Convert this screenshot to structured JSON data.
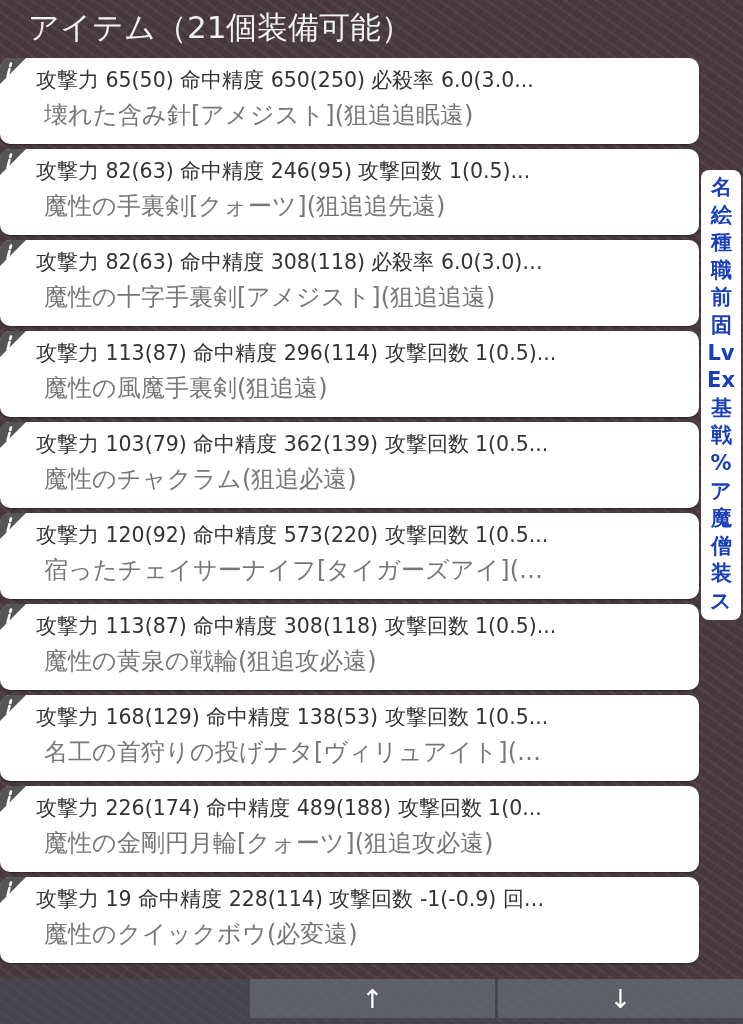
{
  "header": {
    "title": "アイテム（21個装備可能）"
  },
  "items": [
    {
      "stats": "攻撃力 65(50) 命中精度 650(250) 必殺率 6.0(3.0...",
      "name": "壊れた含み針[アメジスト](狙追追眠遠)"
    },
    {
      "stats": "攻撃力 82(63) 命中精度 246(95) 攻撃回数 1(0.5)...",
      "name": "魔性の手裏剣[クォーツ](狙追追先遠)"
    },
    {
      "stats": "攻撃力 82(63) 命中精度 308(118) 必殺率 6.0(3.0)…",
      "name": "魔性の十字手裏剣[アメジスト](狙追追遠)"
    },
    {
      "stats": "攻撃力 113(87) 命中精度 296(114) 攻撃回数 1(0.5)...",
      "name": "魔性の風魔手裏剣(狙追遠)"
    },
    {
      "stats": "攻撃力 103(79) 命中精度 362(139) 攻撃回数 1(0.5...",
      "name": "魔性のチャクラム(狙追必遠)"
    },
    {
      "stats": "攻撃力 120(92) 命中精度 573(220) 攻撃回数 1(0.5...",
      "name": "宿ったチェイサーナイフ[タイガーズアイ](…"
    },
    {
      "stats": "攻撃力 113(87) 命中精度 308(118) 攻撃回数 1(0.5)...",
      "name": "魔性の黄泉の戦輪(狙追攻必遠)"
    },
    {
      "stats": "攻撃力 168(129) 命中精度 138(53) 攻撃回数 1(0.5...",
      "name": "名工の首狩りの投げナタ[ヴィリュアイト](…"
    },
    {
      "stats": "攻撃力 226(174) 命中精度 489(188) 攻撃回数 1(0...",
      "name": "魔性の金剛円月輪[クォーツ](狙追攻必遠)"
    },
    {
      "stats": "攻撃力 19 命中精度 228(114) 攻撃回数 -1(-0.9) 回…",
      "name": "魔性のクイックボウ(必変遠)"
    }
  ],
  "index_bar": [
    "名",
    "絵",
    "種",
    "職",
    "前",
    "固",
    "Lv",
    "Ex",
    "基",
    "戦",
    "%",
    "ア",
    "魔",
    "僧",
    "装",
    "ス"
  ],
  "bottom_bar": {
    "buttons": [
      "↑",
      "↓"
    ]
  }
}
